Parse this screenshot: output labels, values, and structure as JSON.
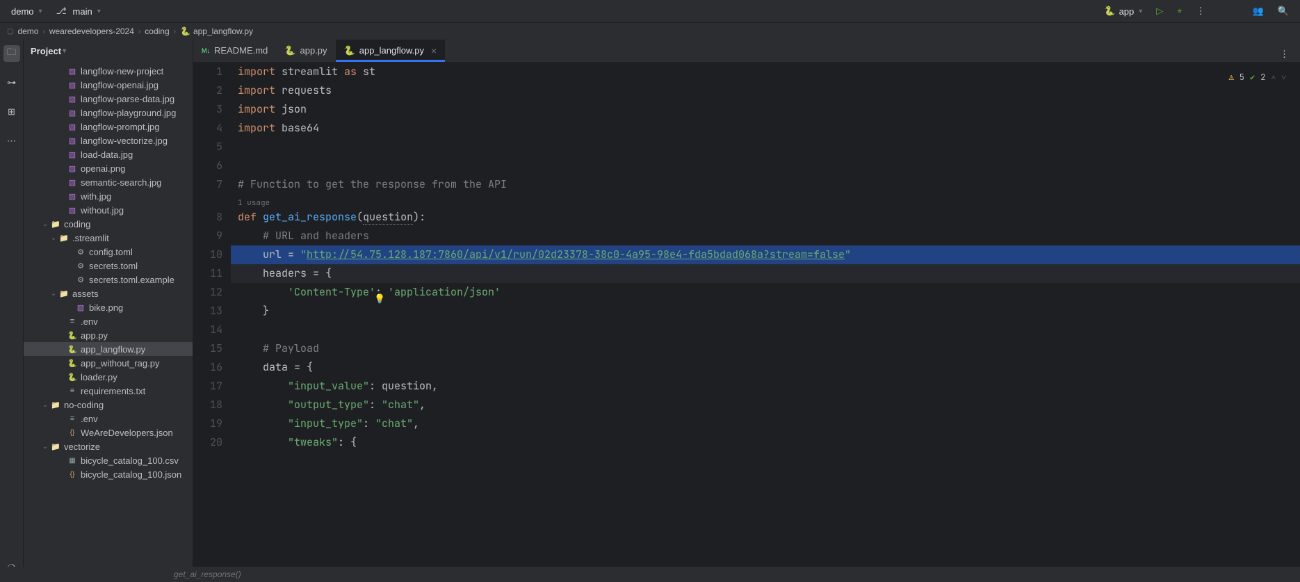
{
  "titlebar": {
    "project": "demo",
    "branch": "main",
    "runConfig": "app"
  },
  "breadcrumb": [
    "demo",
    "wearedevelopers-2024",
    "coding",
    "app_langflow.py"
  ],
  "sidebar": {
    "title": "Project",
    "tree": [
      {
        "d": 4,
        "ico": "img",
        "label": "langflow-new-project"
      },
      {
        "d": 4,
        "ico": "img",
        "label": "langflow-openai.jpg"
      },
      {
        "d": 4,
        "ico": "img",
        "label": "langflow-parse-data.jpg"
      },
      {
        "d": 4,
        "ico": "img",
        "label": "langflow-playground.jpg"
      },
      {
        "d": 4,
        "ico": "img",
        "label": "langflow-prompt.jpg"
      },
      {
        "d": 4,
        "ico": "img",
        "label": "langflow-vectorize.jpg"
      },
      {
        "d": 4,
        "ico": "img",
        "label": "load-data.jpg"
      },
      {
        "d": 4,
        "ico": "img",
        "label": "openai.png"
      },
      {
        "d": 4,
        "ico": "img",
        "label": "semantic-search.jpg"
      },
      {
        "d": 4,
        "ico": "img",
        "label": "with.jpg"
      },
      {
        "d": 4,
        "ico": "img",
        "label": "without.jpg"
      },
      {
        "d": 2,
        "exp": "v",
        "ico": "folder",
        "label": "coding"
      },
      {
        "d": 3,
        "exp": "v",
        "ico": "folder",
        "label": ".streamlit"
      },
      {
        "d": 5,
        "ico": "toml",
        "label": "config.toml"
      },
      {
        "d": 5,
        "ico": "toml",
        "label": "secrets.toml"
      },
      {
        "d": 5,
        "ico": "toml",
        "label": "secrets.toml.example"
      },
      {
        "d": 3,
        "exp": "v",
        "ico": "folder",
        "label": "assets"
      },
      {
        "d": 5,
        "ico": "img",
        "label": "bike.png"
      },
      {
        "d": 4,
        "ico": "txt",
        "label": ".env"
      },
      {
        "d": 4,
        "ico": "py",
        "label": "app.py"
      },
      {
        "d": 4,
        "ico": "py",
        "label": "app_langflow.py",
        "selected": true
      },
      {
        "d": 4,
        "ico": "py",
        "label": "app_without_rag.py"
      },
      {
        "d": 4,
        "ico": "py",
        "label": "loader.py"
      },
      {
        "d": 4,
        "ico": "txt",
        "label": "requirements.txt"
      },
      {
        "d": 2,
        "exp": "v",
        "ico": "folder",
        "label": "no-coding"
      },
      {
        "d": 4,
        "ico": "txt",
        "label": ".env"
      },
      {
        "d": 4,
        "ico": "json",
        "label": "WeAreDevelopers.json"
      },
      {
        "d": 2,
        "exp": "v",
        "ico": "folder",
        "label": "vectorize"
      },
      {
        "d": 4,
        "ico": "csv",
        "label": "bicycle_catalog_100.csv"
      },
      {
        "d": 4,
        "ico": "json",
        "label": "bicycle_catalog_100.json"
      }
    ]
  },
  "tabs": [
    {
      "label": "README.md",
      "ico": "md"
    },
    {
      "label": "app.py",
      "ico": "py"
    },
    {
      "label": "app_langflow.py",
      "ico": "py",
      "active": true
    }
  ],
  "inspections": {
    "warnings": "5",
    "ok": "2"
  },
  "code": {
    "usage": "1 usage",
    "lines": [
      {
        "n": 1,
        "html": "<span class='kw'>import</span> streamlit <span class='kw'>as</span> st"
      },
      {
        "n": 2,
        "html": "<span class='kw'>import</span> requests"
      },
      {
        "n": 3,
        "html": "<span class='kw'>import</span> json"
      },
      {
        "n": 4,
        "html": "<span class='kw'>import</span> base64"
      },
      {
        "n": 5,
        "html": ""
      },
      {
        "n": 6,
        "html": ""
      },
      {
        "n": 7,
        "html": "<span class='cmt'># Function to get the response from the API</span>"
      },
      {
        "n": "usage"
      },
      {
        "n": 8,
        "html": "<span class='kw'>def</span> <span class='fn'>get_ai_response</span>(<span class='param param-u'>question</span>):"
      },
      {
        "n": 9,
        "html": "    <span class='cmt'># URL and headers</span>"
      },
      {
        "n": 10,
        "cls": "selected10",
        "html": "    url = <span class='str'>\"<span class='url'>http://54.75.128.187:7860/api/v1/run/02d23378-38c0-4a95-98e4-fda5bdad068a?stream=false</span>\"</span>"
      },
      {
        "n": 11,
        "cls": "current11",
        "html": "    headers = {"
      },
      {
        "n": 12,
        "html": "        <span class='str'>'Content-Type'</span>: <span class='str'>'application/json'</span>"
      },
      {
        "n": 13,
        "html": "    }"
      },
      {
        "n": 14,
        "html": ""
      },
      {
        "n": 15,
        "html": "    <span class='cmt'># Payload</span>"
      },
      {
        "n": 16,
        "html": "    data = {"
      },
      {
        "n": 17,
        "html": "        <span class='str'>\"input_value\"</span>: question,"
      },
      {
        "n": 18,
        "html": "        <span class='str'>\"output_type\"</span>: <span class='str'>\"chat\"</span>,"
      },
      {
        "n": 19,
        "html": "        <span class='str'>\"input_type\"</span>: <span class='str'>\"chat\"</span>,"
      },
      {
        "n": 20,
        "html": "        <span class='str'>\"tweaks\"</span>: {"
      }
    ]
  },
  "status": {
    "func": "get_ai_response()"
  }
}
